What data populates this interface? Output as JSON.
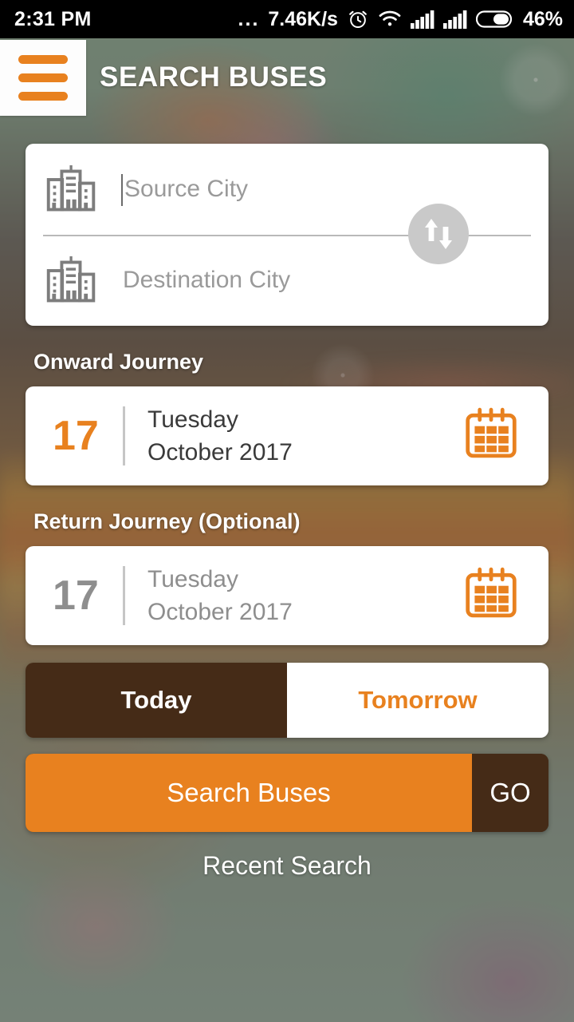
{
  "status_bar": {
    "time": "2:31 PM",
    "dots": "...",
    "network_speed": "7.46K/s",
    "alarm_icon": "alarm-clock-icon",
    "wifi_icon": "wifi-icon",
    "signal_icon_1": "signal-bars-icon",
    "signal_icon_2": "signal-bars-icon",
    "battery_icon": "battery-icon",
    "battery_percent": "46%"
  },
  "app_bar": {
    "menu_icon": "hamburger-menu-icon",
    "title": "SEARCH BUSES"
  },
  "search_card": {
    "source": {
      "icon": "buildings-icon",
      "placeholder": "Source City",
      "value": ""
    },
    "destination": {
      "icon": "buildings-icon",
      "placeholder": "Destination City",
      "value": ""
    },
    "swap_icon": "swap-vertical-arrows-icon"
  },
  "onward": {
    "label": "Onward Journey",
    "day": "17",
    "weekday": "Tuesday",
    "month_year": "October 2017",
    "calendar_icon": "calendar-icon"
  },
  "return": {
    "label": "Return Journey (Optional)",
    "day": "17",
    "weekday": "Tuesday",
    "month_year": "October 2017",
    "calendar_icon": "calendar-icon"
  },
  "quick_date_toggle": {
    "today_label": "Today",
    "tomorrow_label": "Tomorrow",
    "selected": "Today"
  },
  "search_action": {
    "label": "Search Buses",
    "go_label": "GO"
  },
  "recent_search": {
    "label": "Recent Search"
  },
  "colors": {
    "accent_orange": "#e8811f",
    "dark_brown": "#452b17",
    "placeholder_grey": "#9a9a9a",
    "muted_grey": "#8e8e8e",
    "card_white": "#ffffff",
    "status_bar_black": "#000000"
  }
}
